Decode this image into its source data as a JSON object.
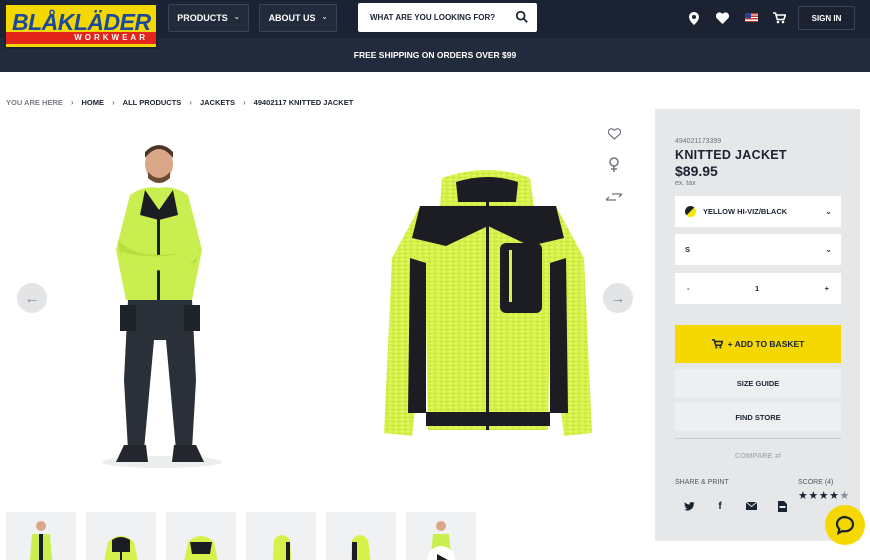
{
  "brand": {
    "name": "BLÅKLÄDER",
    "tagline": "WORKWEAR"
  },
  "nav": {
    "products_label": "PRODUCTS",
    "about_label": "ABOUT US",
    "search_placeholder": "WHAT ARE YOU LOOKING FOR?",
    "signin_label": "SIGN IN"
  },
  "promo": "FREE SHIPPING ON ORDERS OVER $99",
  "breadcrumb": {
    "you_are_here": "YOU ARE HERE",
    "items": [
      "HOME",
      "ALL PRODUCTS",
      "JACKETS",
      "49402117 KNITTED JACKET"
    ]
  },
  "product": {
    "sku": "494021173399",
    "title": "KNITTED JACKET",
    "price": "$89.95",
    "tax_note": "ex. tax",
    "color": "YELLOW HI-VIZ/BLACK",
    "size": "S",
    "quantity": "1",
    "qty_minus": "-",
    "qty_plus": "+",
    "add_to_basket": "+ ADD TO BASKET",
    "size_guide": "SIZE GUIDE",
    "find_store": "FIND STORE",
    "compare": "COMPARE",
    "share_print": "SHARE & PRINT",
    "score": "SCORE (4)",
    "rating": 4.5
  },
  "icons": {
    "location": "location-pin-icon",
    "wishlist": "heart-icon",
    "cart": "cart-icon",
    "search": "search-icon",
    "flag": "us-flag-icon"
  },
  "colors": {
    "navy": "#1b2333",
    "accent": "#f5d800",
    "red": "#e3251b",
    "panel": "#e6e7e9"
  }
}
